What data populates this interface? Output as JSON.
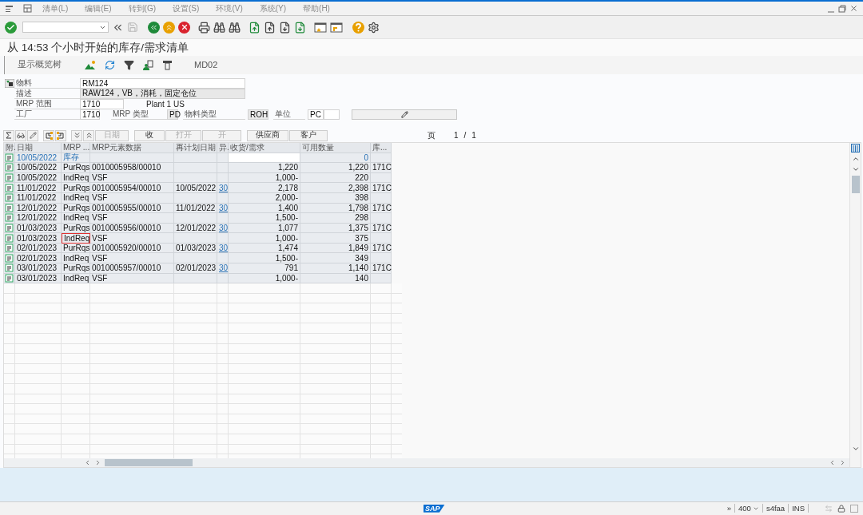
{
  "menu": [
    "清单(L)",
    "编辑(E)",
    "转到(G)",
    "设置(S)",
    "环境(V)",
    "系统(Y)",
    "帮助(H)"
  ],
  "toolbar": {
    "save_disabled": true
  },
  "title": "从 14:53 个小时开始的库存/需求清单",
  "app_toolbar": {
    "overview_tree": "显示概览树",
    "transaction": "MD02"
  },
  "header": {
    "material_label": "物料",
    "material": "RM124",
    "description_label": "描述",
    "description": "RAW124，VB，消耗，固定仓位",
    "mrp_area_label": "MRP 范围",
    "mrp_area": "1710",
    "mrp_area_text": "Plant 1 US",
    "plant_label": "工厂",
    "plant": "1710",
    "mrp_type_label": "MRP 类型",
    "mrp_type": "PD",
    "material_type_label": "物料类型",
    "material_type": "ROH",
    "unit_label": "单位",
    "unit": "PC"
  },
  "grid_toolbar": {
    "buttons": [
      {
        "label": "日期",
        "disabled": true
      },
      {
        "label": "收",
        "disabled": false
      },
      {
        "label": "打开",
        "disabled": true
      },
      {
        "label": "开",
        "disabled": true
      },
      {
        "label": "供应商",
        "disabled": false
      },
      {
        "label": "客户",
        "disabled": false
      }
    ],
    "page_label": "页",
    "page": "1",
    "page_sep": "/",
    "page_total": "1"
  },
  "table": {
    "columns": [
      "附.",
      "日期",
      "MRP ...",
      "MRP元素数据",
      "再计划日期",
      "异.",
      "收货/需求",
      "可用数量",
      "库..."
    ],
    "rows": [
      {
        "kind": "stock",
        "date": "10/05/2022",
        "mrp_element": "库存",
        "available": "0",
        "focused": false
      },
      {
        "kind": "item",
        "date": "10/05/2022",
        "mrp_element": "PurRqs",
        "element_data": "0010005958/00010",
        "receipt_requirement": "1,220",
        "available": "1,220",
        "storage": "171C",
        "focused": false
      },
      {
        "kind": "item",
        "date": "10/05/2022",
        "mrp_element": "IndReq",
        "element_data": "VSF",
        "receipt_requirement": "1,000-",
        "available": "220",
        "focused": false
      },
      {
        "kind": "item",
        "date": "11/01/2022",
        "mrp_element": "PurRqs",
        "element_data": "0010005954/00010",
        "reschedule_date": "10/05/2022",
        "exception": "30",
        "receipt_requirement": "2,178",
        "available": "2,398",
        "storage": "171C",
        "focused": false
      },
      {
        "kind": "item",
        "date": "11/01/2022",
        "mrp_element": "IndReq",
        "element_data": "VSF",
        "receipt_requirement": "2,000-",
        "available": "398",
        "focused": false
      },
      {
        "kind": "item",
        "date": "12/01/2022",
        "mrp_element": "PurRqs",
        "element_data": "0010005955/00010",
        "reschedule_date": "11/01/2022",
        "exception": "30",
        "receipt_requirement": "1,400",
        "available": "1,798",
        "storage": "171C",
        "focused": false
      },
      {
        "kind": "item",
        "date": "12/01/2022",
        "mrp_element": "IndReq",
        "element_data": "VSF",
        "receipt_requirement": "1,500-",
        "available": "298",
        "focused": false
      },
      {
        "kind": "item",
        "date": "01/03/2023",
        "mrp_element": "PurRqs",
        "element_data": "0010005956/00010",
        "reschedule_date": "12/01/2022",
        "exception": "30",
        "receipt_requirement": "1,077",
        "available": "1,375",
        "storage": "171C",
        "focused": false
      },
      {
        "kind": "item",
        "date": "01/03/2023",
        "mrp_element": "IndReq",
        "element_data": "VSF",
        "receipt_requirement": "1,000-",
        "available": "375",
        "focused": true
      },
      {
        "kind": "item",
        "date": "02/01/2023",
        "mrp_element": "PurRqs",
        "element_data": "0010005920/00010",
        "reschedule_date": "01/03/2023",
        "exception": "30",
        "receipt_requirement": "1,474",
        "available": "1,849",
        "storage": "171C",
        "focused": false
      },
      {
        "kind": "item",
        "date": "02/01/2023",
        "mrp_element": "IndReq",
        "element_data": "VSF",
        "receipt_requirement": "1,500-",
        "available": "349",
        "focused": false
      },
      {
        "kind": "item",
        "date": "03/01/2023",
        "mrp_element": "PurRqs",
        "element_data": "0010005957/00010",
        "reschedule_date": "02/01/2023",
        "exception": "30",
        "receipt_requirement": "791",
        "available": "1,140",
        "storage": "171C",
        "focused": false
      },
      {
        "kind": "item",
        "date": "03/01/2023",
        "mrp_element": "IndReq",
        "element_data": "VSF",
        "receipt_requirement": "1,000-",
        "available": "140",
        "focused": false
      }
    ]
  },
  "status_bar": {
    "expand": "»",
    "client": "400",
    "system": "s4faa",
    "mode": "INS",
    "logo": "SAP"
  }
}
